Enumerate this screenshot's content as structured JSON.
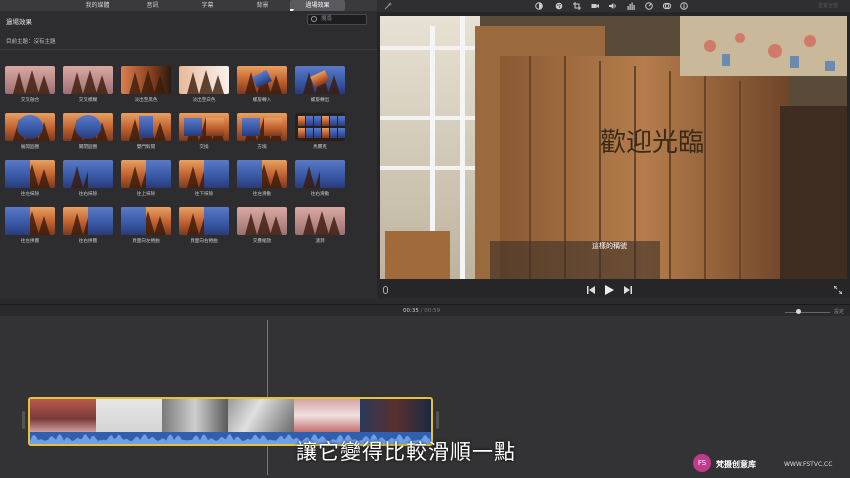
{
  "tabs": [
    "我的媒體",
    "音訊",
    "字幕",
    "背景",
    "過場效果"
  ],
  "active_tab_index": 4,
  "browser": {
    "title": "過場效果",
    "search_placeholder": "搜尋",
    "theme_line": "目前主題：沒有主題"
  },
  "transitions": [
    {
      "label": "交叉融合",
      "style": "dissolve"
    },
    {
      "label": "交叉模糊",
      "style": "blur"
    },
    {
      "label": "淡出至黑色",
      "style": "fade-black"
    },
    {
      "label": "淡出至白色",
      "style": "fade-white"
    },
    {
      "label": "螺旋轉入",
      "style": "spin-in"
    },
    {
      "label": "螺旋轉出",
      "style": "spin-out"
    },
    {
      "label": "展開圓圈",
      "style": "circle-open"
    },
    {
      "label": "關閉圓圈",
      "style": "circle-close"
    },
    {
      "label": "雙門對開",
      "style": "doorway"
    },
    {
      "label": "交換",
      "style": "swap"
    },
    {
      "label": "方塊",
      "style": "cube"
    },
    {
      "label": "馬賽克",
      "style": "mosaic"
    },
    {
      "label": "往左抹除",
      "style": "wipe-left"
    },
    {
      "label": "往右抹除",
      "style": "wipe-right"
    },
    {
      "label": "往上抹除",
      "style": "wipe-up"
    },
    {
      "label": "往下抹除",
      "style": "wipe-down"
    },
    {
      "label": "往左滑動",
      "style": "slide-left"
    },
    {
      "label": "往右滑動",
      "style": "slide-right"
    },
    {
      "label": "往左拼圖",
      "style": "puzzle-left"
    },
    {
      "label": "往右拼圖",
      "style": "puzzle-right"
    },
    {
      "label": "頁面向左捲曲",
      "style": "curl-left"
    },
    {
      "label": "頁面向右捲曲",
      "style": "curl-right"
    },
    {
      "label": "交疊縮放",
      "style": "cross-zoom"
    },
    {
      "label": "漣漪",
      "style": "ripple"
    }
  ],
  "viewer": {
    "reset_all": "重置全部",
    "video_subtitle": "這樣的稱號",
    "sign_text": "歡迎光臨"
  },
  "timeline": {
    "current_time": "00:35",
    "separator": "/",
    "total_time": "00:59",
    "zoom_label": "設定"
  },
  "caption": "讓它變得比較滑順一點",
  "watermark": {
    "logo": "FS",
    "name": "梵摄创意库",
    "url": "WWW.FSTVC.CC"
  },
  "colors": {
    "accent_yellow": "#e4c23a",
    "clip_blue": "#2f5fae",
    "panel": "#2d2d2f"
  }
}
